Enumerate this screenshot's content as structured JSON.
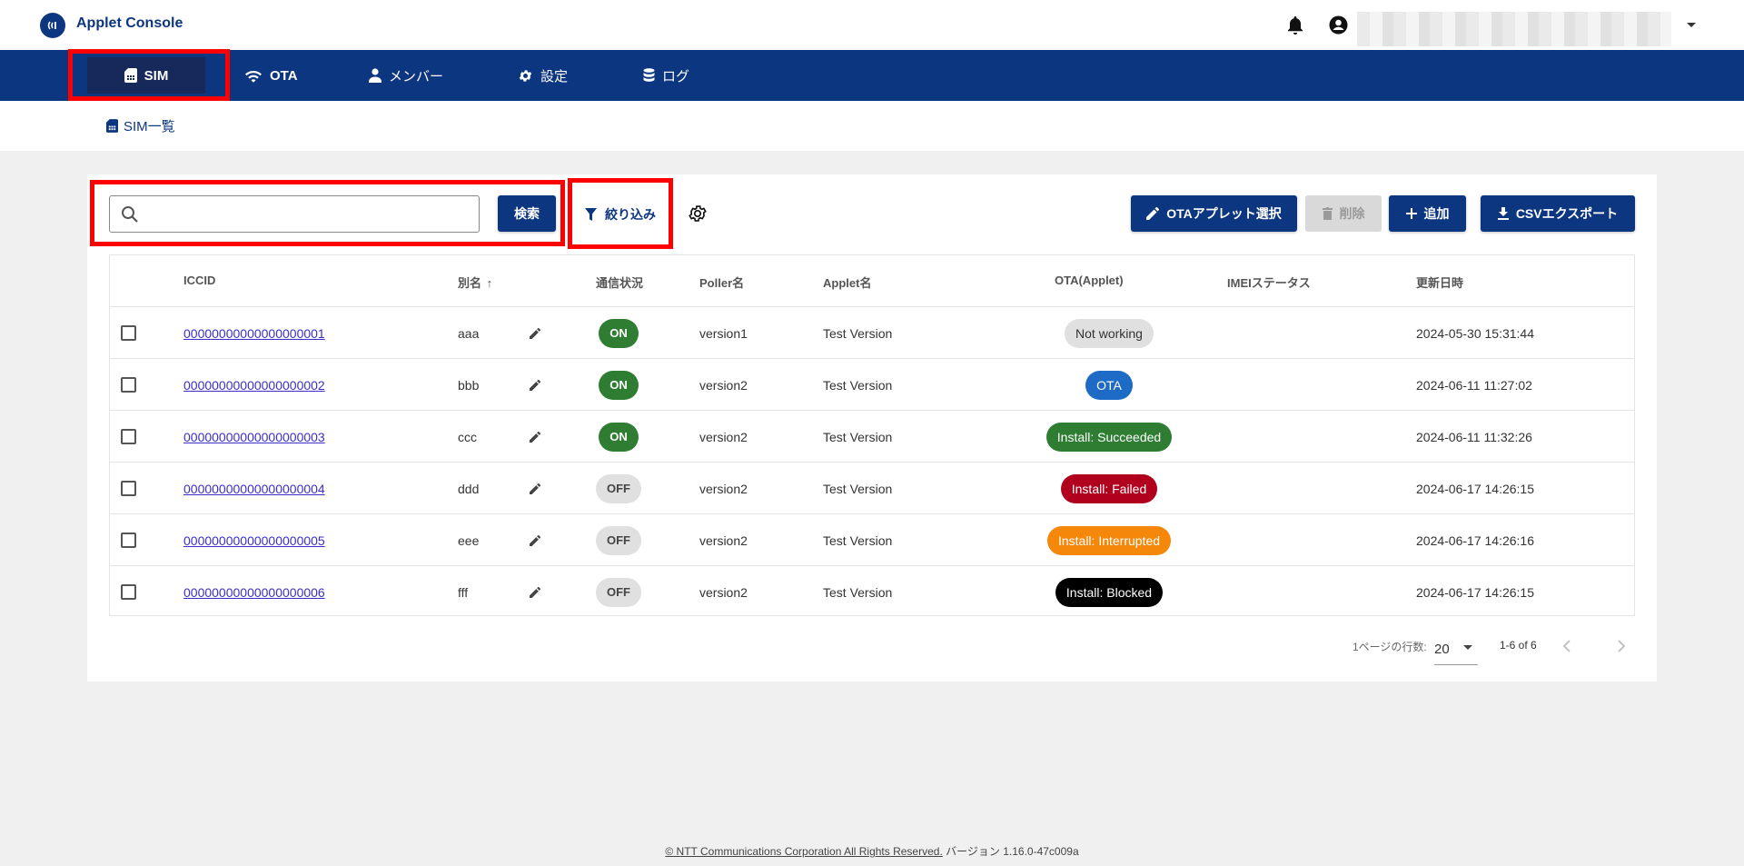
{
  "app": {
    "title": "Applet Console"
  },
  "nav": {
    "items": [
      {
        "label": "SIM",
        "icon": "sim-card-icon",
        "active": true
      },
      {
        "label": "OTA",
        "icon": "wifi-icon"
      },
      {
        "label": "メンバー",
        "icon": "person-icon"
      },
      {
        "label": "設定",
        "icon": "gear-icon"
      },
      {
        "label": "ログ",
        "icon": "database-icon"
      }
    ]
  },
  "breadcrumb": {
    "label": "SIM一覧"
  },
  "toolbar": {
    "search_placeholder": "",
    "search_label": "検索",
    "filter_label": "絞り込み",
    "ota_select_label": "OTAアプレット選択",
    "delete_label": "削除",
    "add_label": "追加",
    "csv_export_label": "CSVエクスポート"
  },
  "table": {
    "columns": [
      "ICCID",
      "別名",
      "通信状況",
      "Poller名",
      "Applet名",
      "OTA(Applet)",
      "IMEIステータス",
      "更新日時"
    ],
    "sort_indicator": "↑",
    "rows": [
      {
        "iccid": "00000000000000000001",
        "alias": "aaa",
        "status": "ON",
        "poller": "version1",
        "applet": "Test Version",
        "ota": "Not working",
        "imei": "",
        "updated": "2024-05-30 15:31:44"
      },
      {
        "iccid": "00000000000000000002",
        "alias": "bbb",
        "status": "ON",
        "poller": "version2",
        "applet": "Test Version",
        "ota": "OTA",
        "imei": "",
        "updated": "2024-06-11 11:27:02"
      },
      {
        "iccid": "00000000000000000003",
        "alias": "ccc",
        "status": "ON",
        "poller": "version2",
        "applet": "Test Version",
        "ota": "Install: Succeeded",
        "imei": "",
        "updated": "2024-06-11 11:32:26"
      },
      {
        "iccid": "00000000000000000004",
        "alias": "ddd",
        "status": "OFF",
        "poller": "version2",
        "applet": "Test Version",
        "ota": "Install: Failed",
        "imei": "",
        "updated": "2024-06-17 14:26:15"
      },
      {
        "iccid": "00000000000000000005",
        "alias": "eee",
        "status": "OFF",
        "poller": "version2",
        "applet": "Test Version",
        "ota": "Install: Interrupted",
        "imei": "",
        "updated": "2024-06-17 14:26:16"
      },
      {
        "iccid": "00000000000000000006",
        "alias": "fff",
        "status": "OFF",
        "poller": "version2",
        "applet": "Test Version",
        "ota": "Install: Blocked",
        "imei": "",
        "updated": "2024-06-17 14:26:15"
      }
    ]
  },
  "pagination": {
    "rows_per_page_label": "1ページの行数:",
    "rows_per_page": "20",
    "range": "1-6 of 6"
  },
  "footer": {
    "copyright": "© NTT Communications Corporation All Rights Reserved.",
    "version": "バージョン 1.16.0-47c009a"
  },
  "colors": {
    "brand": "#0d3680",
    "on": "#2e7d32",
    "off": "#e0e0e0",
    "ota": "#1e6bc6",
    "succeeded": "#2e7d32",
    "failed": "#b0001e",
    "interrupted": "#f5870a",
    "blocked": "#000000",
    "not_working": "#e0e0e0",
    "highlight": "#ff0000"
  }
}
